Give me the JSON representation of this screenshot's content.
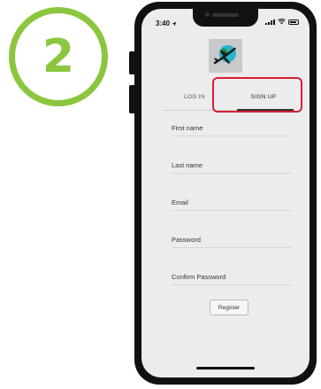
{
  "step": {
    "number": "2"
  },
  "status_bar": {
    "time": "3:40"
  },
  "tabs": [
    {
      "label": "LOG IN"
    },
    {
      "label": "SIGN UP"
    }
  ],
  "form": {
    "fields": [
      {
        "label": "First name"
      },
      {
        "label": "Last name"
      },
      {
        "label": "Email"
      },
      {
        "label": "Password"
      },
      {
        "label": "Confirm Password"
      }
    ],
    "register_label": "Register"
  },
  "colors": {
    "step_accent": "#8cc63f",
    "highlight": "#d61f2f",
    "logo_circle": "#27b3c9",
    "logo_plane": "#1a1a1a"
  },
  "icons": {
    "app_logo": "airplane-over-globe-icon",
    "location": "location-arrow-icon",
    "signal": "signal-icon",
    "wifi": "wifi-icon",
    "battery": "battery-icon"
  }
}
